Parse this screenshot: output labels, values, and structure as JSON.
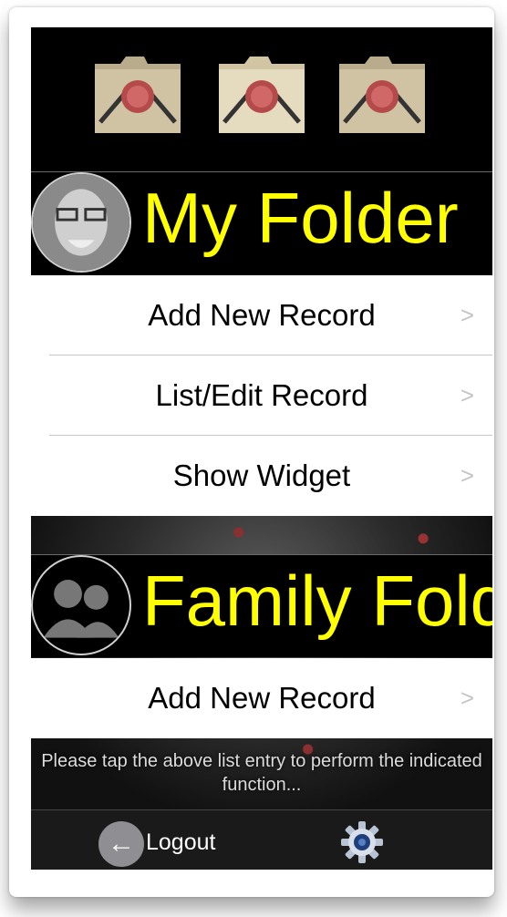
{
  "my_folder": {
    "title": "My Folder",
    "items": [
      {
        "label": "Add New Record"
      },
      {
        "label": "List/Edit Record"
      },
      {
        "label": "Show Widget"
      }
    ]
  },
  "family_folder": {
    "title": "Family Folder",
    "items": [
      {
        "label": "Add New Record"
      }
    ]
  },
  "hint": "Please tap the above list entry to perform the indicated function...",
  "bottom_bar": {
    "logout_label": "Logout"
  },
  "icons": {
    "chevron": "chevron-right-icon",
    "back": "arrow-left-icon",
    "settings": "gear-icon"
  },
  "colors": {
    "title_yellow": "#ffff00",
    "background": "#000000"
  }
}
